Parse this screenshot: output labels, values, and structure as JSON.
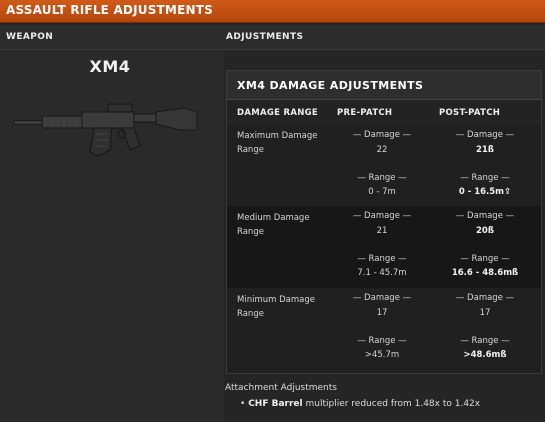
{
  "banner": {
    "title": "ASSAULT RIFLE ADJUSTMENTS"
  },
  "columns": {
    "weapon": "WEAPON",
    "adjustments": "ADJUSTMENTS"
  },
  "weapon": {
    "name": "XM4",
    "image": "rifle-image"
  },
  "table": {
    "title": "XM4 DAMAGE ADJUSTMENTS",
    "headers": [
      "DAMAGE RANGE",
      "PRE-PATCH",
      "POST-PATCH"
    ],
    "rows": [
      {
        "label_line1": "Maximum Damage",
        "label_line2": "Range",
        "pre_damage_label": "— Damage —",
        "pre_damage": "22",
        "post_damage_label": "— Damage —",
        "post_damage": "21ß",
        "pre_range_label": "— Range —",
        "pre_range": "0 - 7m",
        "post_range_label": "— Range —",
        "post_range": "0 - 16.5m⇪"
      },
      {
        "label_line1": "Medium Damage",
        "label_line2": "Range",
        "pre_damage_label": "— Damage —",
        "pre_damage": "21",
        "post_damage_label": "— Damage —",
        "post_damage": "20ß",
        "pre_range_label": "— Range —",
        "pre_range": "7.1 - 45.7m",
        "post_range_label": "— Range —",
        "post_range": "16.6 - 48.6mß"
      },
      {
        "label_line1": "Minimum Damage",
        "label_line2": "Range",
        "pre_damage_label": "— Damage —",
        "pre_damage": "17",
        "post_damage_label": "— Damage —",
        "post_damage": "17",
        "pre_range_label": "— Range —",
        "pre_range": ">45.7m",
        "post_range_label": "— Range —",
        "post_range": ">48.6mß"
      }
    ]
  },
  "attachments": {
    "title": "Attachment Adjustments",
    "items": [
      {
        "bullet": "•",
        "name": "CHF Barrel",
        "text": "multiplier reduced from 1.48x to 1.42x"
      }
    ]
  }
}
